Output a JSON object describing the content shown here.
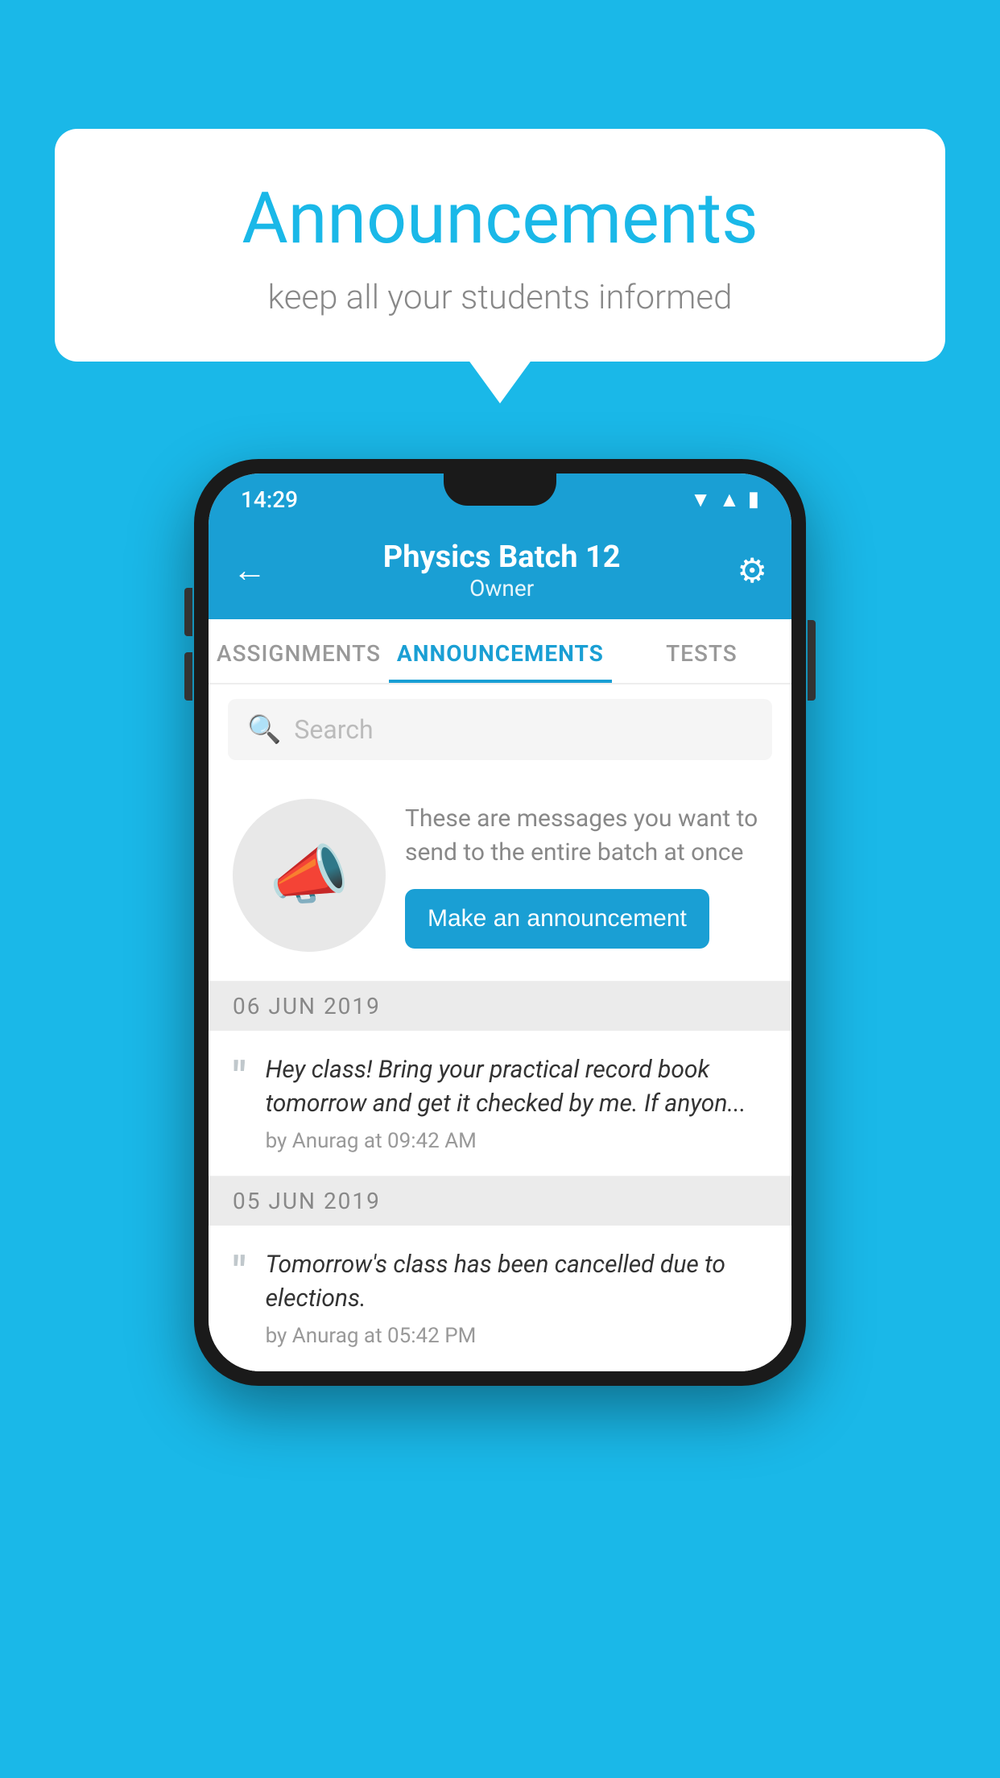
{
  "background_color": "#1ab8e8",
  "speech_bubble": {
    "title": "Announcements",
    "subtitle": "keep all your students informed"
  },
  "phone": {
    "status_bar": {
      "time": "14:29",
      "icons": [
        "wifi",
        "signal",
        "battery"
      ]
    },
    "header": {
      "title": "Physics Batch 12",
      "subtitle": "Owner",
      "back_label": "←",
      "gear_label": "⚙"
    },
    "tabs": [
      {
        "label": "ASSIGNMENTS",
        "active": false
      },
      {
        "label": "ANNOUNCEMENTS",
        "active": true
      },
      {
        "label": "TESTS",
        "active": false
      }
    ],
    "search": {
      "placeholder": "Search"
    },
    "promo": {
      "description": "These are messages you want to send to the entire batch at once",
      "button_label": "Make an announcement"
    },
    "announcements": [
      {
        "date": "06  JUN  2019",
        "text": "Hey class! Bring your practical record book tomorrow and get it checked by me. If anyon...",
        "meta": "by Anurag at 09:42 AM"
      },
      {
        "date": "05  JUN  2019",
        "text": "Tomorrow's class has been cancelled due to elections.",
        "meta": "by Anurag at 05:42 PM"
      }
    ]
  }
}
